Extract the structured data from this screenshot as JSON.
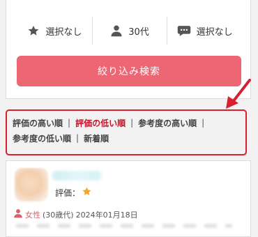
{
  "filters": {
    "rating": "選択なし",
    "age": "30代",
    "comment": "選択なし"
  },
  "search_button": "絞り込み検索",
  "sort": {
    "separator": "|",
    "options": [
      {
        "label": "評価の高い順",
        "active": false
      },
      {
        "label": "評価の低い順",
        "active": true
      },
      {
        "label": "参考度の高い順",
        "active": false
      },
      {
        "label": "参考度の低い順",
        "active": false
      },
      {
        "label": "新着順",
        "active": false
      }
    ]
  },
  "review": {
    "rating_label": "評価：",
    "rating_stars": 1,
    "gender": "女性",
    "age_group": "(30歳代)",
    "date": "2024年01月18日"
  },
  "colors": {
    "accent": "#ec6674",
    "active_sort": "#c8142a",
    "annotation": "#d92031",
    "star": "#f5a623",
    "gender_icon": "#d9606b"
  },
  "icons": {
    "rating_filter": "star-icon",
    "age_filter": "person-icon",
    "comment_filter": "speech-bubble-icon",
    "gender": "person-icon"
  }
}
